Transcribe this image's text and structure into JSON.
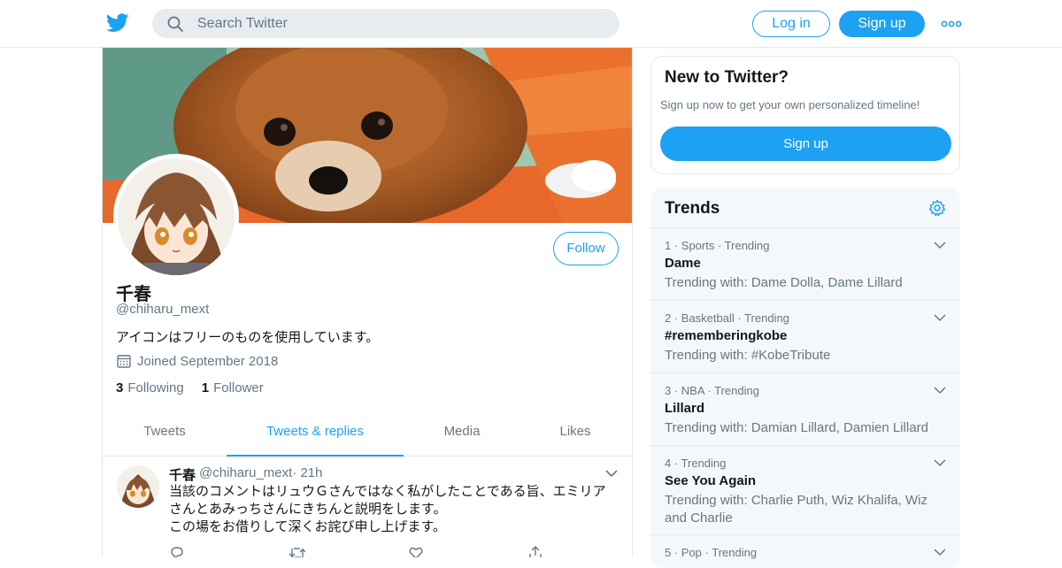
{
  "header": {
    "search_placeholder": "Search Twitter",
    "login_label": "Log in",
    "signup_label": "Sign up"
  },
  "profile": {
    "follow_label": "Follow",
    "name": "千春",
    "handle": "@chiharu_mext",
    "bio": "アイコンはフリーのものを使用しています。",
    "joined": "Joined September 2018",
    "following_count": "3",
    "following_label": "Following",
    "follower_count": "1",
    "follower_label": "Follower"
  },
  "tabs": [
    {
      "label": "Tweets"
    },
    {
      "label": "Tweets & replies"
    },
    {
      "label": "Media"
    },
    {
      "label": "Likes"
    }
  ],
  "tweet": {
    "name": "千春",
    "handle": "@chiharu_mext",
    "time": "· 21h",
    "lines": [
      "当該のコメントはリュウＧさんではなく私がしたことである旨、エミリア",
      "さんとあみっちさんにきちんと説明をします。",
      "この場をお借りして深くお詫び申し上げます。"
    ]
  },
  "sidebar": {
    "new_title": "New to Twitter?",
    "new_sub": "Sign up now to get your own personalized timeline!",
    "signup_label": "Sign up",
    "trends_title": "Trends",
    "trends": [
      {
        "meta": "1 · Sports · Trending",
        "title": "Dame",
        "with": "Trending with: Dame Dolla, Dame Lillard"
      },
      {
        "meta": "2 · Basketball · Trending",
        "title": "#rememberingkobe",
        "with": "Trending with: #KobeTribute"
      },
      {
        "meta": "3 · NBA · Trending",
        "title": "Lillard",
        "with": "Trending with: Damian Lillard, Damien Lillard"
      },
      {
        "meta": "4 · Trending",
        "title": "See You Again",
        "with": "Trending with: Charlie Puth, Wiz Khalifa, Wiz and Charlie"
      },
      {
        "meta": "5 · Pop · Trending",
        "title": "",
        "with": ""
      }
    ]
  },
  "colors": {
    "accent": "#1da1f2",
    "muted_text": "#657786",
    "border": "#e1e8ed",
    "panel_bg": "#f5f8fa"
  }
}
